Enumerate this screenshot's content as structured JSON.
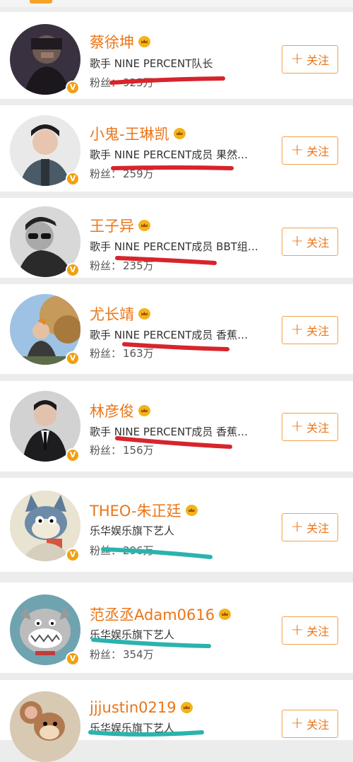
{
  "list": {
    "follow_label": "关注",
    "fans_label": "粉丝：",
    "verified_badge": "V",
    "users": [
      {
        "name": "蔡徐坤",
        "desc": "歌手 NINE PERCENT队长",
        "fans": "925万",
        "avatar": "dark-portrait"
      },
      {
        "name": "小鬼-王琳凯",
        "desc": "歌手 NINE PERCENT成员 果然…",
        "fans": "259万",
        "avatar": "boy-in-jacket"
      },
      {
        "name": "王子异",
        "desc": "歌手 NINE PERCENT成员 BBT组…",
        "fans": "235万",
        "avatar": "bw-sunglasses"
      },
      {
        "name": "尤长靖",
        "desc": "歌手 NINE PERCENT成员 香蕉…",
        "fans": "163万",
        "avatar": "outdoor-tree"
      },
      {
        "name": "林彦俊",
        "desc": "歌手 NINE PERCENT成员 香蕉…",
        "fans": "156万",
        "avatar": "suit-portrait"
      },
      {
        "name": "THEO-朱正廷",
        "desc": "乐华娱乐旗下艺人",
        "fans": "296万",
        "avatar": "tom-cat-cartoon"
      },
      {
        "name": "范丞丞Adam0616",
        "desc": "乐华娱乐旗下艺人",
        "fans": "354万",
        "avatar": "bulldog-cartoon"
      },
      {
        "name": "jjjustin0219",
        "desc": "乐华娱乐旗下艺人",
        "fans": "",
        "avatar": "jerry-mouse-cartoon"
      }
    ]
  },
  "colors": {
    "accent": "#eb7517",
    "button_border": "#f0a24c",
    "red_marker": "#d8242b",
    "teal_marker": "#2bb3ac",
    "badge": "#f0a011"
  }
}
